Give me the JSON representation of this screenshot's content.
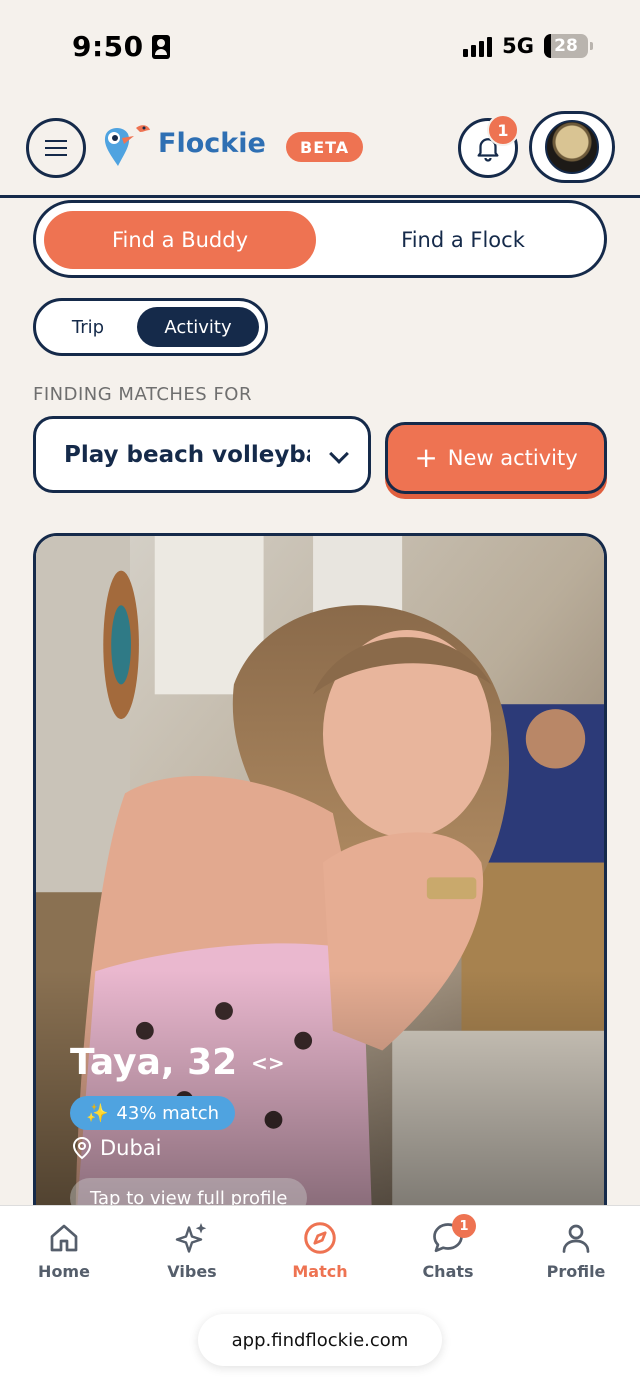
{
  "status_bar": {
    "time": "9:50",
    "network": "5G",
    "battery": "28"
  },
  "header": {
    "brand": "Flockie",
    "beta_label": "BETA",
    "notification_count": "1"
  },
  "mode_switch": {
    "active": "Find a Buddy",
    "inactive": "Find a Flock"
  },
  "type_switch": {
    "trip": "Trip",
    "activity": "Activity"
  },
  "finding_label": "FINDING MATCHES FOR",
  "activity_select": {
    "value": "Play beach volleyba"
  },
  "new_activity": {
    "plus": "+",
    "label": "New activity"
  },
  "profile": {
    "name": "Taya, 32",
    "match_icon": "✨",
    "match": "43% match",
    "location": "Dubai",
    "tap_hint": "Tap to view full profile"
  },
  "nav": {
    "home": "Home",
    "vibes": "Vibes",
    "match": "Match",
    "chats": "Chats",
    "chats_badge": "1",
    "profile": "Profile"
  },
  "url": "app.findflockie.com",
  "colors": {
    "accent": "#ee7352",
    "navy": "#152a4a",
    "brand_blue": "#2e6fb3",
    "match_blue": "#4fa3e0",
    "background": "#f5f1ec"
  },
  "icons": [
    "id-card-icon",
    "signal-icon",
    "battery-icon",
    "menu-icon",
    "bird-logo-icon",
    "bell-icon",
    "chevron-down-icon",
    "plus-icon",
    "code-icon",
    "sparkles-icon",
    "location-pin-icon",
    "home-icon",
    "sparkle-star-icon",
    "compass-icon",
    "chat-bubble-icon",
    "person-icon"
  ]
}
